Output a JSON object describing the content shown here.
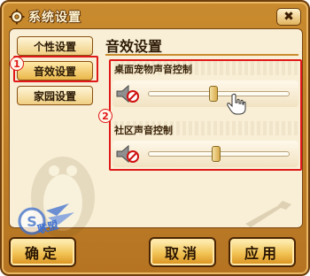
{
  "window": {
    "title": "系统设置",
    "close_label": "✖"
  },
  "sidebar": {
    "items": [
      {
        "label": "个性设置"
      },
      {
        "label": "音效设置"
      },
      {
        "label": "家园设置"
      }
    ]
  },
  "annotations": {
    "marker_1": "1",
    "marker_2": "2"
  },
  "panel": {
    "title": "音效设置",
    "sections": [
      {
        "label": "桌面宠物声音控制",
        "volume_fraction": 0.46
      },
      {
        "label": "社区声音控制",
        "volume_fraction": 0.48
      }
    ]
  },
  "buttons": {
    "confirm": "确定",
    "cancel": "取消",
    "apply": "应用"
  },
  "watermark": {
    "text": "联盟"
  },
  "colors": {
    "frame": "#c98b2e",
    "panel_bg": "#f8efd6",
    "highlight": "#e01919"
  }
}
